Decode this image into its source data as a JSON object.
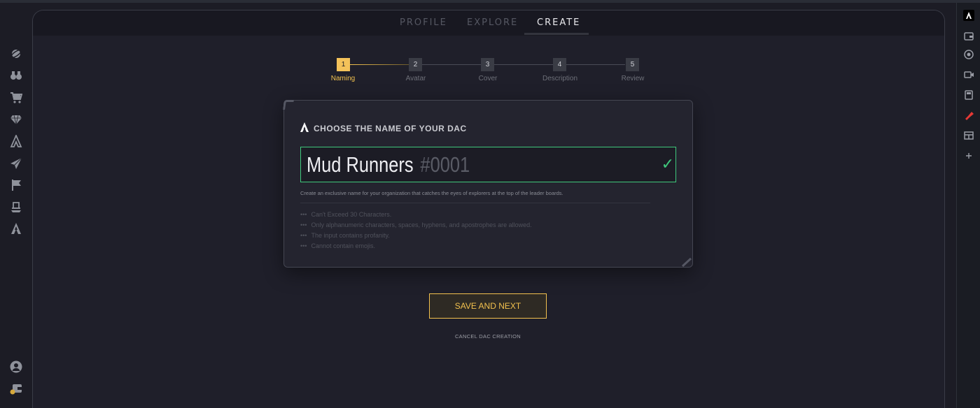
{
  "tabs": [
    {
      "label": "PROFILE",
      "active": false
    },
    {
      "label": "EXPLORE",
      "active": false
    },
    {
      "label": "CREATE",
      "active": true
    }
  ],
  "stepper": {
    "steps": [
      {
        "number": "1",
        "label": "Naming",
        "active": true
      },
      {
        "number": "2",
        "label": "Avatar",
        "active": false
      },
      {
        "number": "3",
        "label": "Cover",
        "active": false
      },
      {
        "number": "4",
        "label": "Description",
        "active": false
      },
      {
        "number": "5",
        "label": "Review",
        "active": false
      }
    ]
  },
  "card": {
    "title": "CHOOSE THE NAME OF YOUR DAC",
    "name_value": "Mud Runners",
    "name_suffix": "#0001",
    "helper": "Create an exclusive name for your organization that catches the eyes of explorers at the top of the leader boards.",
    "rules": [
      "Can't Exceed 30 Characters.",
      "Only alphanumeric characters, spaces, hyphens, and apostrophes are allowed.",
      "The input contains profanity.",
      "Cannot contain emojis."
    ]
  },
  "actions": {
    "save_label": "SAVE AND NEXT",
    "cancel_label": "CANCEL DAC CREATION"
  },
  "left_sidebar": {
    "icons": [
      "planet-icon",
      "binoculars-icon",
      "cart-icon",
      "diamond-icon",
      "brand-icon",
      "rocket-icon",
      "flag-icon",
      "cards-icon",
      "brand-alt-icon"
    ],
    "bottom_icons": [
      "user-icon",
      "wallet-icon"
    ]
  },
  "right_sidebar": {
    "icons": [
      "brand-logo-icon",
      "wallet-icon",
      "record-icon",
      "video-icon",
      "save-icon",
      "pin-icon",
      "layout-icon",
      "plus-icon"
    ]
  },
  "colors": {
    "accent": "#f2c14e",
    "success": "#3fc97c",
    "background": "#1c1c25"
  }
}
